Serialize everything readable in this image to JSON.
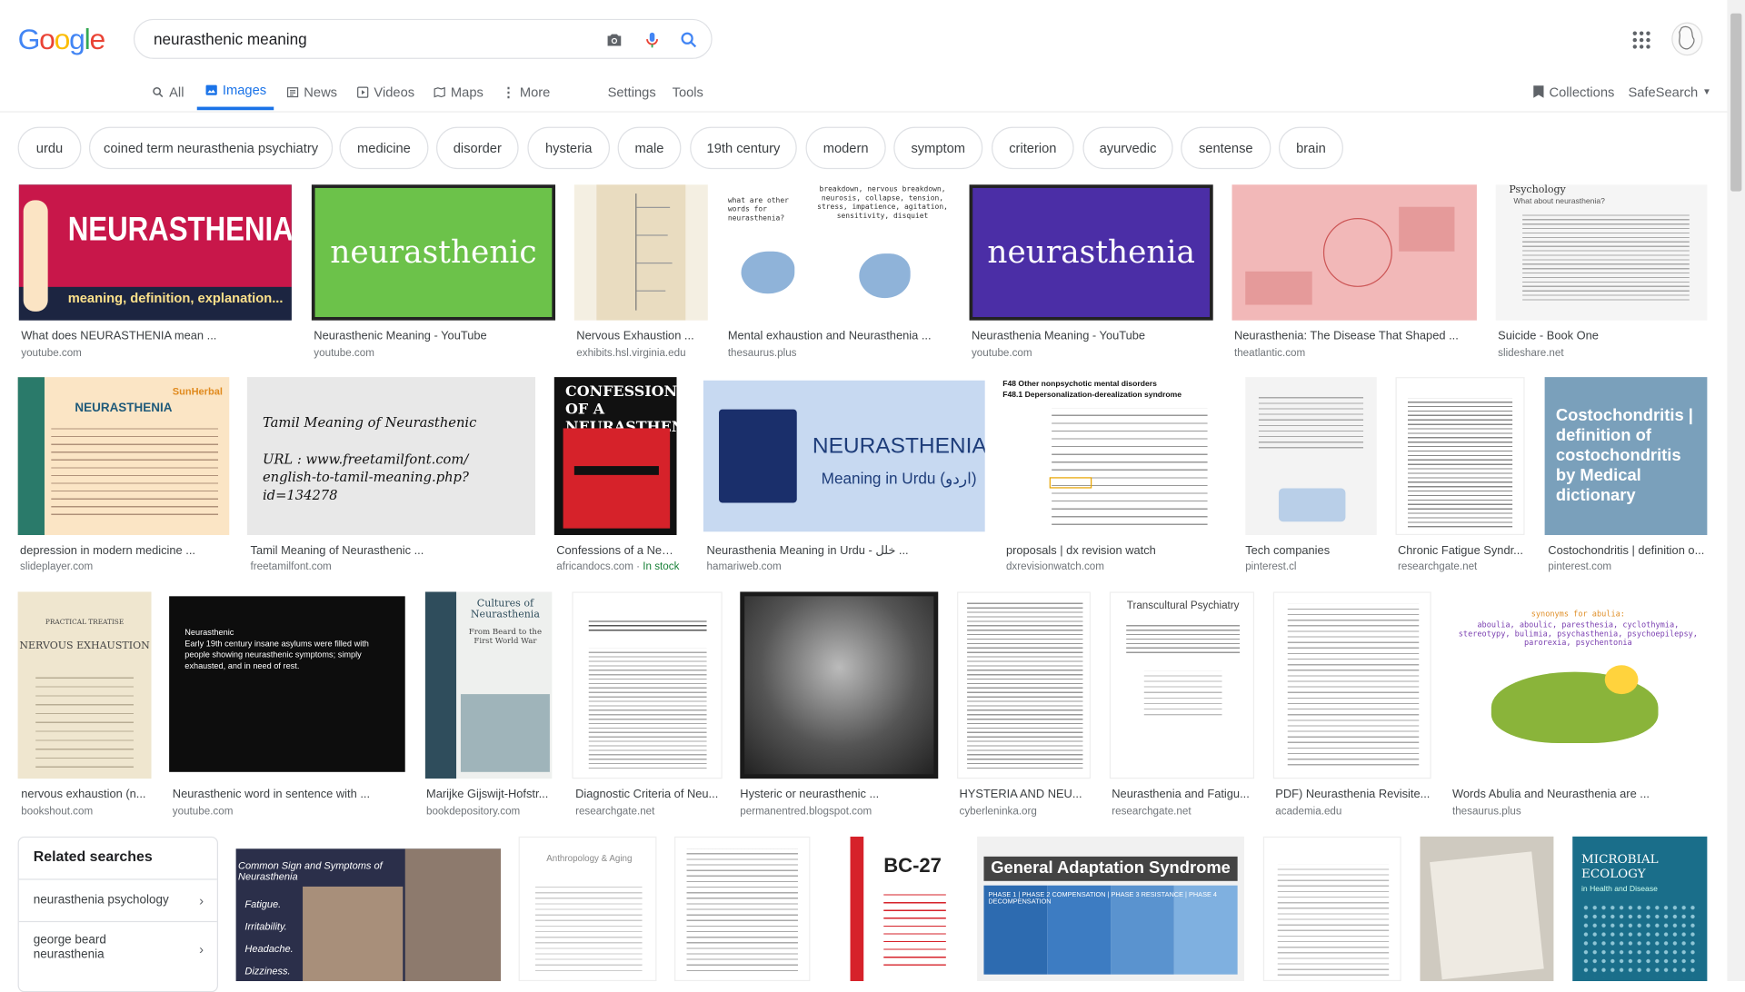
{
  "logo": {
    "text": "Google",
    "letters": [
      "G",
      "o",
      "o",
      "g",
      "l",
      "e"
    ],
    "colors": [
      "#4285F4",
      "#EA4335",
      "#FBBC05",
      "#4285F4",
      "#34A853",
      "#EA4335"
    ]
  },
  "search": {
    "value": "neurasthenic meaning"
  },
  "tabs": [
    {
      "label": "All",
      "icon": "search-icon"
    },
    {
      "label": "Images",
      "icon": "image-icon",
      "active": true
    },
    {
      "label": "News",
      "icon": "news-icon"
    },
    {
      "label": "Videos",
      "icon": "video-icon"
    },
    {
      "label": "Maps",
      "icon": "map-icon"
    },
    {
      "label": "More",
      "icon": "more-vert-icon"
    },
    {
      "label": "Settings"
    },
    {
      "label": "Tools"
    }
  ],
  "header_right": {
    "collections": "Collections",
    "safesearch": "SafeSearch"
  },
  "chips": [
    "urdu",
    "coined term neurasthenia psychiatry",
    "medicine",
    "disorder",
    "hysteria",
    "male",
    "19th century",
    "modern",
    "symptom",
    "criterion",
    "ayurvedic",
    "sentense",
    "brain"
  ],
  "results": [
    {
      "caption": "What does NEURASTHENIA mean ...",
      "source": "youtube.com",
      "text": "NEURASTHENIA",
      "subtext": "meaning, definition, explanation..."
    },
    {
      "caption": "Neurasthenic Meaning - YouTube",
      "source": "youtube.com",
      "text": "neurasthenic"
    },
    {
      "caption": "Nervous Exhaustion ...",
      "source": "exhibits.hsl.virginia.edu"
    },
    {
      "caption": "Mental exhaustion and Neurasthenia ...",
      "source": "thesaurus.plus",
      "text": "what are other words for neurasthenia?",
      "subtext": "breakdown, nervous breakdown, neurosis, collapse, tension, stress, impatience, agitation, sensitivity, disquiet"
    },
    {
      "caption": "Neurasthenia Meaning - YouTube",
      "source": "youtube.com",
      "text": "neurasthenia"
    },
    {
      "caption": "Neurasthenia: The Disease That Shaped ...",
      "source": "theatlantic.com"
    },
    {
      "caption": "Suicide - Book One",
      "source": "slideshare.net",
      "text": "Psychology",
      "subtext": "What about neurasthenia?"
    },
    {
      "caption": "depression in modern medicine ...",
      "source": "slideplayer.com",
      "text": "NEURASTHENIA",
      "subtext": "SunHerbal"
    },
    {
      "caption": "Tamil Meaning of Neurasthenic ...",
      "source": "freetamilfont.com",
      "text": "Tamil Meaning of Neurasthenic",
      "subtext": "URL : www.freetamilfont.com/ english-to-tamil-meaning.php?id=134278"
    },
    {
      "caption": "Confessions of a Neur...",
      "source": "africandocs.com",
      "stock": "In stock",
      "text": "CONFESSIONS OF A NEURASTHENIC"
    },
    {
      "caption": "Neurasthenia Meaning in Urdu - خلل ...",
      "source": "hamariweb.com",
      "text": "NEURASTHENIA",
      "subtext": "Meaning in Urdu (اردو)"
    },
    {
      "caption": "proposals | dx revision watch",
      "source": "dxrevisionwatch.com",
      "text": "F48 Other nonpsychotic mental disorders",
      "subtext": "F48.1 Depersonalization-derealization syndrome"
    },
    {
      "caption": "Tech companies",
      "source": "pinterest.cl"
    },
    {
      "caption": "Chronic Fatigue Syndr...",
      "source": "researchgate.net"
    },
    {
      "caption": "Costochondritis | definition o...",
      "source": "pinterest.com",
      "text": "Costochondritis | definition of costochondritis by Medical dictionary"
    },
    {
      "caption": "nervous exhaustion (n...",
      "source": "bookshout.com",
      "text": "NERVOUS EXHAUSTION",
      "subtext": "PRACTICAL TREATISE"
    },
    {
      "caption": "Neurasthenic word in sentence with ...",
      "source": "youtube.com",
      "text": "Neurasthenic",
      "subtext": "Early 19th century insane asylums were filled with people showing neurasthenic symptoms; simply exhausted, and in need of rest."
    },
    {
      "caption": "Marijke Gijswijt-Hofstr...",
      "source": "bookdepository.com",
      "text": "Cultures of Neurasthenia",
      "subtext": "From Beard to the First World War"
    },
    {
      "caption": "Diagnostic Criteria of Neu...",
      "source": "researchgate.net"
    },
    {
      "caption": "Hysteric or neurasthenic ...",
      "source": "permanentred.blogspot.com"
    },
    {
      "caption": "HYSTERIA AND NEU...",
      "source": "cyberleninka.org"
    },
    {
      "caption": "Neurasthenia and Fatigu...",
      "source": "researchgate.net",
      "text": "Transcultural Psychiatry"
    },
    {
      "caption": "PDF) Neurasthenia Revisite...",
      "source": "academia.edu"
    },
    {
      "caption": "Words Abulia and Neurasthenia are ...",
      "source": "thesaurus.plus",
      "text": "synonyms for abulia:",
      "subtext": "aboulia, aboulic, paresthesia, cyclothymia, stereotypy, bulimia, psychasthenia, psychoepilepsy, parorexia, psychentonia"
    },
    {
      "text": "Common Sign and Symptoms of Neurasthenia",
      "subtext": "Fatigue. Irritability. Headache. Dizziness."
    },
    {
      "text": "Anthropology & Aging"
    },
    {},
    {
      "text": "BC-27"
    },
    {
      "text": "General Adaptation Syndrome",
      "subtext": "PHASE 1 | PHASE 2 COMPENSATION | PHASE 3 RESISTANCE | PHASE 4 DECOMPENSATION"
    },
    {},
    {},
    {
      "text": "MICROBIAL ECOLOGY",
      "subtext": "in Health and Disease"
    }
  ],
  "related": {
    "title": "Related searches",
    "items": [
      "neurasthenia psychology",
      "george beard neurasthenia"
    ]
  },
  "colors": {
    "accent": "#1a73e8"
  }
}
